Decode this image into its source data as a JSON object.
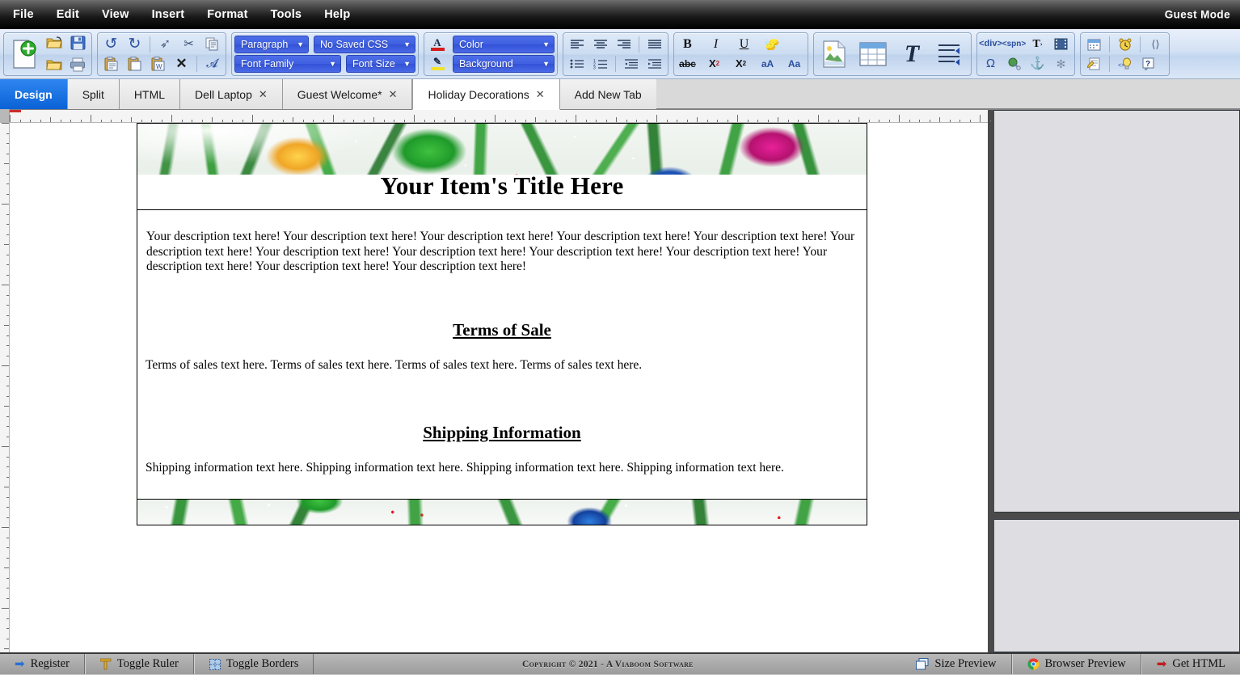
{
  "app": {
    "mode_label": "Guest Mode",
    "copyright": "Copyright © 2021 - A Viaboom Software"
  },
  "menubar": {
    "items": [
      {
        "label": "File"
      },
      {
        "label": "Edit"
      },
      {
        "label": "View"
      },
      {
        "label": "Insert"
      },
      {
        "label": "Format"
      },
      {
        "label": "Tools"
      },
      {
        "label": "Help"
      }
    ]
  },
  "toolbar": {
    "file_group": {
      "row1": [
        {
          "name": "new-document-icon",
          "glyph": "🗎"
        },
        {
          "name": "open-folder-icon",
          "glyph": "📂"
        },
        {
          "name": "save-icon",
          "glyph": "💾"
        }
      ],
      "row2": [
        {
          "name": "folder-icon",
          "glyph": "📁"
        },
        {
          "name": "print-icon",
          "glyph": "🖨"
        }
      ]
    },
    "edit_group": {
      "row1": [
        {
          "name": "undo-icon",
          "glyph": "↶"
        },
        {
          "name": "redo-icon",
          "glyph": "↷"
        },
        {
          "name": "select-pointer-icon",
          "glyph": "➤"
        },
        {
          "name": "cut-icon",
          "glyph": "✂"
        },
        {
          "name": "copy-icon",
          "glyph": "⧉"
        }
      ],
      "row2": [
        {
          "name": "paste-icon",
          "glyph": "📋"
        },
        {
          "name": "paste-plain-icon",
          "glyph": "📋"
        },
        {
          "name": "paste-word-icon",
          "glyph": "📋"
        },
        {
          "name": "delete-icon",
          "glyph": "✕"
        },
        {
          "name": "find-replace-icon",
          "glyph": "🔍"
        }
      ]
    },
    "style_dropdowns": {
      "paragraph": "Paragraph",
      "saved_css": "No Saved CSS",
      "font_family": "Font Family",
      "font_size": "Font Size"
    },
    "color_dropdowns": {
      "color": "Color",
      "background": "Background",
      "color_accent": "#d61b1b",
      "background_accent": "#f2e22a"
    },
    "align_group": {
      "row1": [
        {
          "name": "align-left-icon",
          "glyph": "≡"
        },
        {
          "name": "align-center-icon",
          "glyph": "≡"
        },
        {
          "name": "align-right-icon",
          "glyph": "≡"
        },
        {
          "name": "align-justify-icon",
          "glyph": "≡"
        }
      ],
      "row2": [
        {
          "name": "bullet-list-icon",
          "glyph": "☰"
        },
        {
          "name": "numbered-list-icon",
          "glyph": "☰"
        },
        {
          "name": "outdent-icon",
          "glyph": "⬅"
        },
        {
          "name": "indent-icon",
          "glyph": "➡"
        }
      ]
    },
    "format_group": {
      "row1": [
        {
          "name": "bold-icon",
          "glyph": "B"
        },
        {
          "name": "italic-icon",
          "glyph": "I"
        },
        {
          "name": "underline-icon",
          "glyph": "U"
        },
        {
          "name": "clear-formatting-icon",
          "glyph": "🧹"
        }
      ],
      "row2": [
        {
          "name": "strikethrough-icon",
          "glyph": "abc"
        },
        {
          "name": "superscript-icon",
          "glyph": "X²"
        },
        {
          "name": "subscript-icon",
          "glyph": "X₂"
        },
        {
          "name": "uppercase-icon",
          "glyph": "aA"
        },
        {
          "name": "lowercase-icon",
          "glyph": "Aa"
        }
      ]
    },
    "insert_group": [
      {
        "name": "insert-image-icon",
        "glyph": "🖼"
      },
      {
        "name": "insert-table-icon",
        "glyph": "▦"
      },
      {
        "name": "insert-text-art-icon",
        "glyph": "T"
      },
      {
        "name": "line-break-icon",
        "glyph": "↵"
      }
    ],
    "code_group": {
      "row1": [
        {
          "name": "insert-div-icon",
          "glyph": "div"
        },
        {
          "name": "insert-span-icon",
          "glyph": "span"
        },
        {
          "name": "insert-text-icon",
          "glyph": "T"
        },
        {
          "name": "insert-media-icon",
          "glyph": "🎞"
        }
      ],
      "row2": [
        {
          "name": "special-character-icon",
          "glyph": "Ω"
        },
        {
          "name": "insert-link-icon",
          "glyph": "🌐"
        },
        {
          "name": "insert-anchor-icon",
          "glyph": "⚓"
        },
        {
          "name": "remove-link-icon",
          "glyph": "✳"
        }
      ]
    },
    "tools_group": {
      "row1": [
        {
          "name": "calendar-icon",
          "glyph": "📅"
        },
        {
          "name": "clock-icon",
          "glyph": "⏰"
        },
        {
          "name": "clean-code-icon",
          "glyph": "🧹"
        }
      ],
      "row2": [
        {
          "name": "notes-icon",
          "glyph": "📝"
        },
        {
          "name": "tips-icon",
          "glyph": "💡"
        },
        {
          "name": "help-icon",
          "glyph": "?"
        }
      ]
    }
  },
  "tabbar": {
    "view_tabs": [
      {
        "label": "Design",
        "active": true
      },
      {
        "label": "Split",
        "active": false
      },
      {
        "label": "HTML",
        "active": false
      }
    ],
    "doc_tabs": [
      {
        "label": "Dell Laptop",
        "close": "✕",
        "active": false
      },
      {
        "label": "Guest Welcome*",
        "close": "✕",
        "active": false
      },
      {
        "label": "Holiday Decorations",
        "close": "✕",
        "active": true
      }
    ],
    "add_tab_label": "Add New Tab"
  },
  "document": {
    "title": "Your Item's Title Here",
    "description": "Your description text here! Your description text here! Your description text here! Your description text here! Your description text here! Your description text here! Your description text here! Your description text here! Your description text here! Your description text here! Your description text here! Your description text here! Your description text here!",
    "sections": [
      {
        "heading": "Terms of Sale",
        "body": "Terms of sales text here. Terms of sales text here. Terms of sales text here. Terms of sales text here."
      },
      {
        "heading": "Shipping Information",
        "body": "Shipping information text here. Shipping information text here. Shipping information text here. Shipping information text here."
      }
    ],
    "banner_alt": "holiday-christmas-pine-branches-ornaments-banner"
  },
  "statusbar": {
    "left_buttons": [
      {
        "label": "Register",
        "icon": "arrow-right-icon",
        "glyph": "➡",
        "color": "#2a6fd4"
      },
      {
        "label": "Toggle Ruler",
        "icon": "ruler-icon",
        "glyph": "⌵",
        "color": "#d59b1f"
      },
      {
        "label": "Toggle Borders",
        "icon": "borders-icon",
        "glyph": "▦",
        "color": "#3b7dd8"
      }
    ],
    "right_buttons": [
      {
        "label": "Size Preview",
        "icon": "window-size-icon",
        "glyph": "❐",
        "color": "#3b7dd8"
      },
      {
        "label": "Browser Preview",
        "icon": "chrome-browser-icon",
        "glyph": "●",
        "color": "#2aa84f"
      },
      {
        "label": "Get HTML",
        "icon": "arrow-right-red-icon",
        "glyph": "➡",
        "color": "#c01d1d"
      }
    ]
  }
}
